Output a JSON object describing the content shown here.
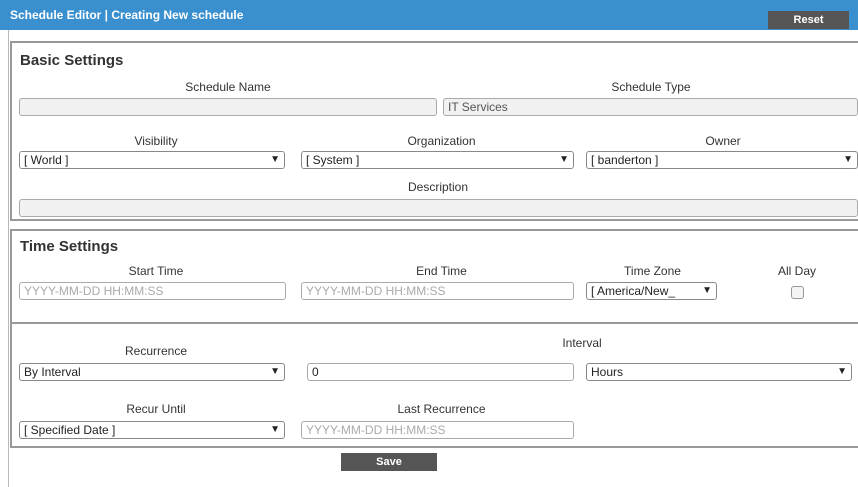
{
  "header": {
    "title": "Schedule Editor | Creating New schedule",
    "reset_label": "Reset"
  },
  "basic": {
    "section_title": "Basic Settings",
    "schedule_name_label": "Schedule Name",
    "schedule_name_value": "",
    "schedule_type_label": "Schedule Type",
    "schedule_type_value": "IT Services",
    "visibility_label": "Visibility",
    "visibility_value": "[ World ]",
    "organization_label": "Organization",
    "organization_value": "[ System ]",
    "owner_label": "Owner",
    "owner_value": "[ banderton ]",
    "description_label": "Description",
    "description_value": ""
  },
  "time": {
    "section_title": "Time Settings",
    "start_time_label": "Start Time",
    "start_time_placeholder": "YYYY-MM-DD HH:MM:SS",
    "end_time_label": "End Time",
    "end_time_placeholder": "YYYY-MM-DD HH:MM:SS",
    "time_zone_label": "Time Zone",
    "time_zone_value": "[ America/New_",
    "all_day_label": "All Day",
    "all_day_checked": false,
    "recurrence_label": "Recurrence",
    "recurrence_value": "By Interval",
    "interval_label": "Interval",
    "interval_value": "0",
    "interval_unit_value": "Hours",
    "recur_until_label": "Recur Until",
    "recur_until_value": "[ Specified Date ]",
    "last_recurrence_label": "Last Recurrence",
    "last_recurrence_placeholder": "YYYY-MM-DD HH:MM:SS"
  },
  "footer": {
    "save_label": "Save"
  },
  "colors": {
    "titlebar": "#3a90cf",
    "button": "#555555",
    "border": "#999999"
  },
  "icons": {
    "dropdown": "dropdown-arrow-icon"
  }
}
